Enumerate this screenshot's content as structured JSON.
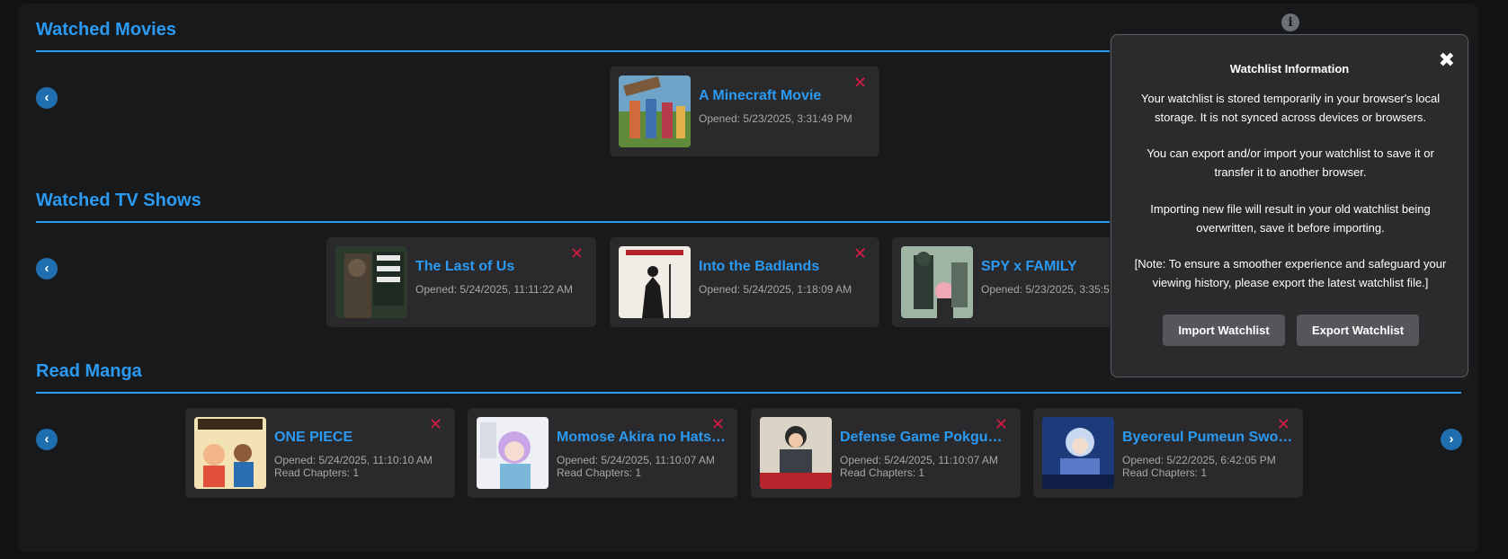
{
  "sections": {
    "movies": {
      "title": "Watched Movies",
      "items": [
        {
          "title": "A Minecraft Movie",
          "opened": "Opened: 5/23/2025, 3:31:49 PM"
        }
      ]
    },
    "tv": {
      "title": "Watched TV Shows",
      "items": [
        {
          "title": "The Last of Us",
          "opened": "Opened: 5/24/2025, 11:11:22 AM"
        },
        {
          "title": "Into the Badlands",
          "opened": "Opened: 5/24/2025, 1:18:09 AM"
        },
        {
          "title": "SPY x FAMILY",
          "opened": "Opened: 5/23/2025, 3:35:5"
        }
      ]
    },
    "manga": {
      "title": "Read Manga",
      "items": [
        {
          "title": "ONE PIECE",
          "opened": "Opened: 5/24/2025, 11:10:10 AM",
          "chapters": "Read Chapters: 1"
        },
        {
          "title": "Momose Akira no Hatsukoi Hatan-chuu.",
          "opened": "Opened: 5/24/2025, 11:10:07 AM",
          "chapters": "Read Chapters: 1"
        },
        {
          "title": "Defense Game Pokgun Kaesang",
          "opened": "Opened: 5/24/2025, 11:10:07 AM",
          "chapters": "Read Chapters: 1"
        },
        {
          "title": "Byeoreul Pumeun Sword Master",
          "opened": "Opened: 5/22/2025, 6:42:05 PM",
          "chapters": "Read Chapters: 1"
        }
      ]
    }
  },
  "icons": {
    "prev": "chevron-left-icon",
    "next": "chevron-right-icon",
    "remove": "close-icon",
    "info": "info-icon"
  },
  "glyphs": {
    "prev": "‹",
    "next": "›",
    "remove": "✕",
    "info": "i",
    "close": "✖"
  },
  "modal": {
    "title": "Watchlist Information",
    "p1": "Your watchlist is stored temporarily in your browser's local storage. It is not synced across devices or browsers.",
    "p2": "You can export and/or import your watchlist to save it or transfer it to another browser.",
    "p3": "Importing new file will result in your old watchlist being overwritten, save it before importing.",
    "p4": "[Note: To ensure a smoother experience and safeguard your viewing history, please export the latest watchlist file.]",
    "import_label": "Import Watchlist",
    "export_label": "Export Watchlist"
  },
  "colors": {
    "accent": "#2b9af3",
    "remove": "#d81b45",
    "card": "#2a2a2c",
    "background": "#18191b"
  }
}
